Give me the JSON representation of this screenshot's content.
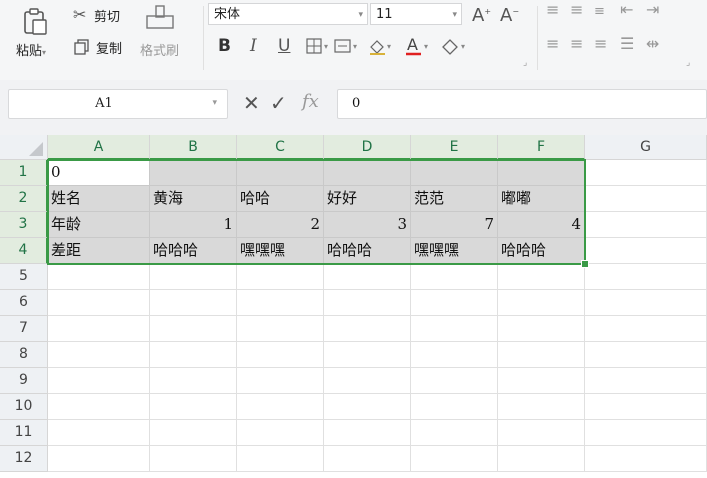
{
  "ribbon": {
    "paste": "粘贴",
    "cut": "剪切",
    "copy": "复制",
    "format_painter": "格式刷",
    "font_name": "宋体",
    "font_size": "11",
    "bold": "B",
    "italic": "I",
    "underline": "U"
  },
  "formula_bar": {
    "name_box": "A1",
    "fx_label": "fx",
    "value": "0"
  },
  "sheet": {
    "columns": [
      "A",
      "B",
      "C",
      "D",
      "E",
      "F",
      "G"
    ],
    "rows": [
      "1",
      "2",
      "3",
      "4",
      "5",
      "6",
      "7",
      "8",
      "9",
      "10",
      "11",
      "12"
    ],
    "cells": [
      [
        "0",
        "",
        "",
        "",
        "",
        ""
      ],
      [
        "姓名",
        "黄海",
        "哈哈",
        "好好",
        "范范",
        "嘟嘟"
      ],
      [
        "年龄",
        "1",
        "2",
        "3",
        "7",
        "4"
      ],
      [
        "差距",
        "哈哈哈",
        "嘿嘿嘿",
        "哈哈哈",
        "嘿嘿嘿",
        "哈哈哈"
      ]
    ],
    "active_cell": "A1",
    "selection": "A1:F4"
  },
  "colors": {
    "selection": "#3a9a46",
    "selected_header": "#217346"
  }
}
